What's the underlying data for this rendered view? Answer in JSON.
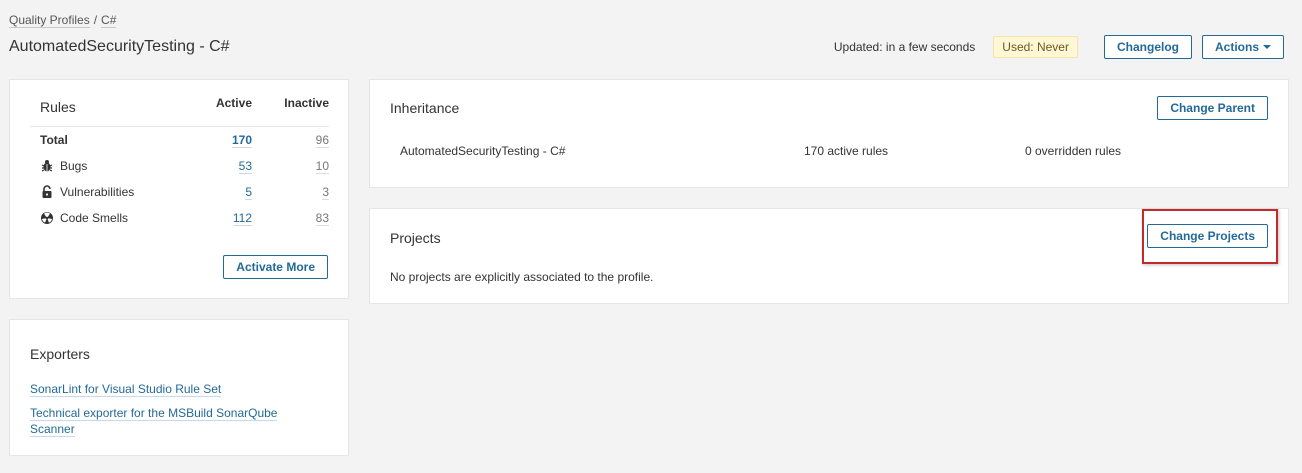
{
  "breadcrumb": {
    "parent": "Quality Profiles",
    "separator": "/",
    "current": "C#"
  },
  "page": {
    "title": "AutomatedSecurityTesting - C#"
  },
  "header": {
    "updated": "Updated: in a few seconds",
    "used": "Used: Never",
    "changelog_label": "Changelog",
    "actions_label": "Actions"
  },
  "rules": {
    "title": "Rules",
    "col_active": "Active",
    "col_inactive": "Inactive",
    "rows": [
      {
        "label": "Total",
        "active": "170",
        "inactive": "96",
        "icon": "none"
      },
      {
        "label": "Bugs",
        "active": "53",
        "inactive": "10",
        "icon": "bug-icon"
      },
      {
        "label": "Vulnerabilities",
        "active": "5",
        "inactive": "3",
        "icon": "lock-icon"
      },
      {
        "label": "Code Smells",
        "active": "112",
        "inactive": "83",
        "icon": "code-smell-icon"
      }
    ],
    "activate_more_label": "Activate More"
  },
  "exporters": {
    "title": "Exporters",
    "links": [
      "SonarLint for Visual Studio Rule Set",
      "Technical exporter for the MSBuild SonarQube Scanner"
    ]
  },
  "inheritance": {
    "title": "Inheritance",
    "change_parent_label": "Change Parent",
    "profile_name": "AutomatedSecurityTesting - C#",
    "active_rules": "170 active rules",
    "overridden_rules": "0 overridden rules"
  },
  "projects": {
    "title": "Projects",
    "change_projects_label": "Change Projects",
    "empty_message": "No projects are explicitly associated to the profile."
  },
  "colors": {
    "accent": "#236a97",
    "highlight": "#c22b2b",
    "badge_bg": "#fff7d6"
  }
}
